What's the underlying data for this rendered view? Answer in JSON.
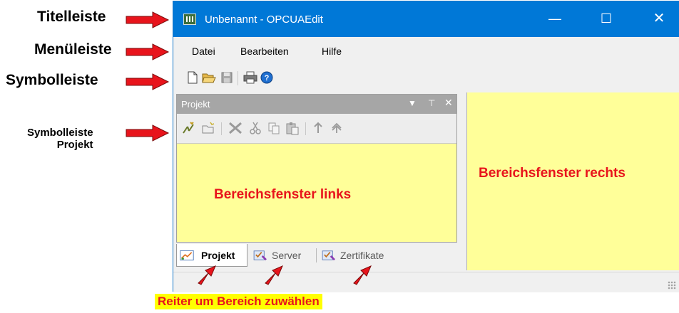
{
  "callouts": {
    "titelleiste": "Titelleiste",
    "menueleiste": "Menüleiste",
    "symbolleiste": "Symbolleiste",
    "symbolleiste_projekt_line1": "Symbolleiste",
    "symbolleiste_projekt_line2": "Projekt",
    "reiter": "Reiter um Bereich zuwählen"
  },
  "window": {
    "title": "Unbenannt - OPCUAEdit",
    "title_buttons": [
      "minimize-icon",
      "maximize-icon",
      "close-icon"
    ]
  },
  "menu": {
    "items": [
      "Datei",
      "Bearbeiten",
      "Hilfe"
    ]
  },
  "toolbar": {
    "icons": [
      "new-file-icon",
      "open-folder-icon",
      "save-icon",
      "print-icon",
      "help-icon"
    ]
  },
  "project_panel": {
    "title": "Projekt",
    "header_buttons": [
      "dropdown-icon",
      "pin-icon",
      "close-icon"
    ],
    "toolbar_icons": [
      "add-server-icon",
      "add-folder-icon",
      "delete-icon",
      "cut-icon",
      "copy-icon",
      "paste-icon",
      "move-up-icon",
      "move-top-icon"
    ]
  },
  "areas": {
    "left_label": "Bereichsfenster links",
    "right_label": "Bereichsfenster rechts"
  },
  "tabs": [
    {
      "label": "Projekt",
      "active": true
    },
    {
      "label": "Server",
      "active": false
    },
    {
      "label": "Zertifikate",
      "active": false
    }
  ],
  "colors": {
    "titlebar": "#0078d7",
    "area_background": "#ffff99",
    "annotation_red": "#e8141c",
    "highlight_yellow": "#ffff00"
  }
}
